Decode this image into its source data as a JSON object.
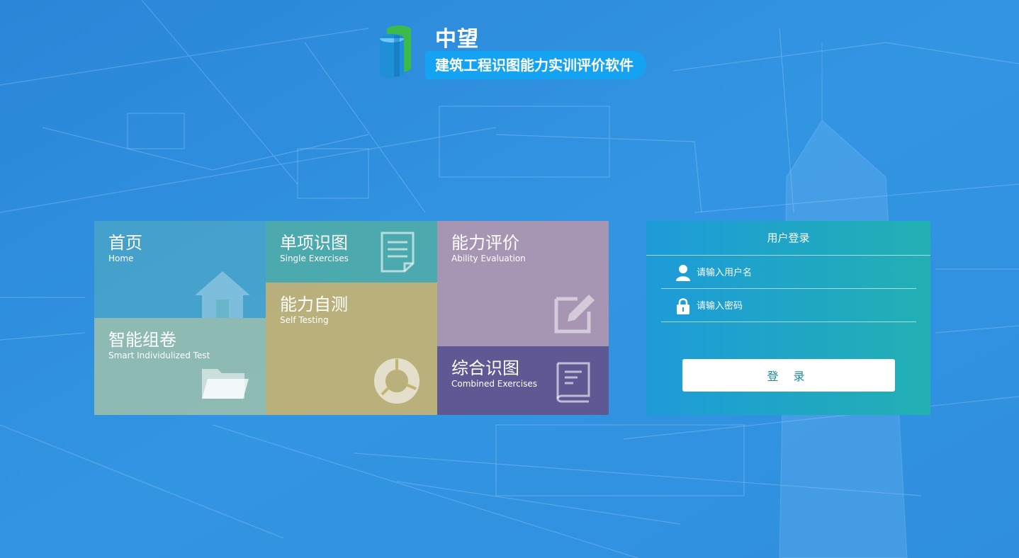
{
  "header": {
    "brand_name": "中望",
    "subtitle": "建筑工程识图能力实训评价软件",
    "logo_icon": "scroll-logo-icon"
  },
  "tiles": [
    {
      "id": "home",
      "title": "首页",
      "subtitle": "Home",
      "icon": "house-icon"
    },
    {
      "id": "single",
      "title": "单项识图",
      "subtitle": "Single Exercises",
      "icon": "document-icon"
    },
    {
      "id": "ability",
      "title": "能力评价",
      "subtitle": "Ability Evaluation",
      "icon": "edit-pencil-icon"
    },
    {
      "id": "smart",
      "title": "智能组卷",
      "subtitle": "Smart Individulized Test",
      "icon": "folder-icon"
    },
    {
      "id": "self",
      "title": "能力自测",
      "subtitle": "Self Testing",
      "icon": "donut-chart-icon"
    },
    {
      "id": "combined",
      "title": "综合识图",
      "subtitle": "Combined Exercises",
      "icon": "book-icon"
    }
  ],
  "login": {
    "title": "用户登录",
    "username_placeholder": "请输入用户名",
    "password_placeholder": "请输入密码",
    "submit_label": "登 录",
    "user_icon": "user-icon",
    "lock_icon": "lock-icon"
  },
  "colors": {
    "background": "#2f8fde",
    "subtitle_pill": "#14a2f2",
    "login_gradient_start": "#1d9bd9",
    "login_gradient_end": "#22b0b3",
    "button_text": "#1d8a9a"
  }
}
